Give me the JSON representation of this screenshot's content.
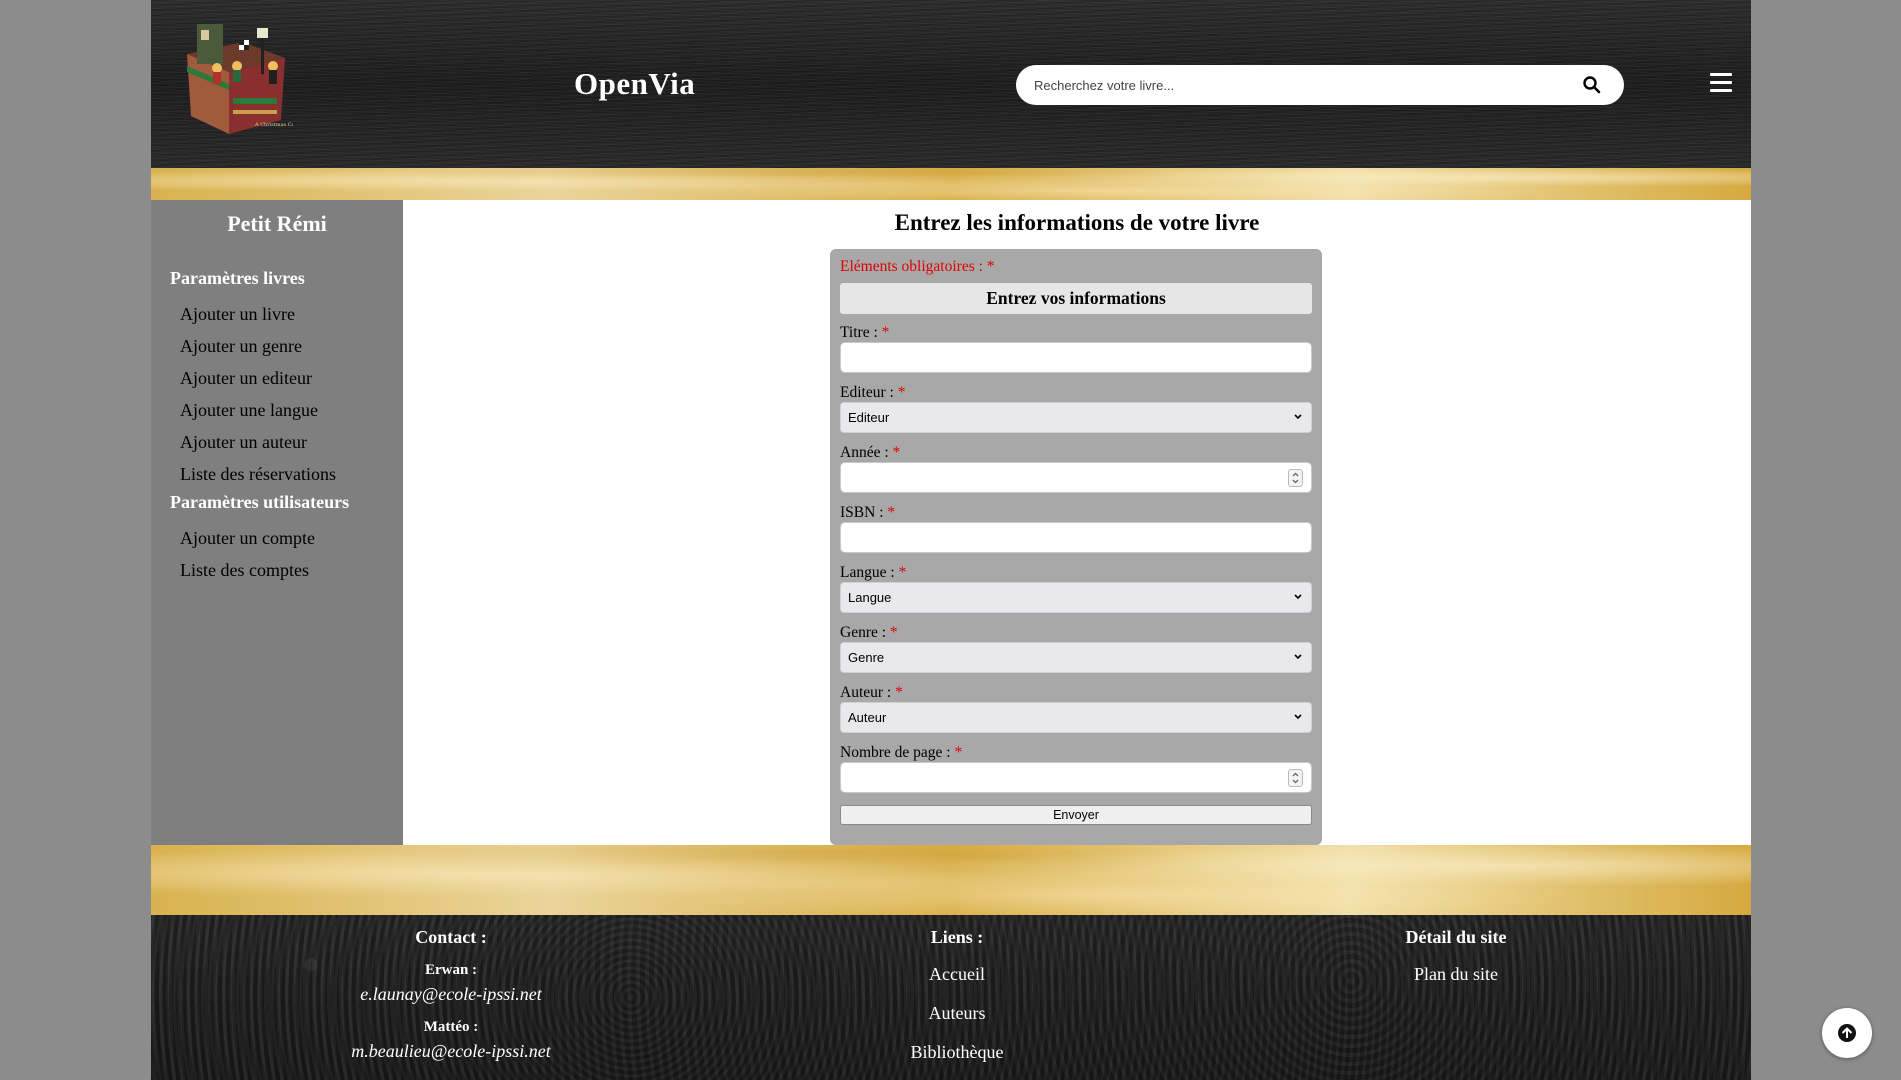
{
  "header": {
    "brand": "OpenVia",
    "search_placeholder": "Recherchez votre livre..."
  },
  "sidebar": {
    "user": "Petit Rémi",
    "sections": [
      {
        "title": "Paramètres livres",
        "links": [
          "Ajouter un livre",
          "Ajouter un genre",
          "Ajouter un editeur",
          "Ajouter une langue",
          "Ajouter un auteur",
          "Liste des réservations"
        ]
      },
      {
        "title": "Paramètres utilisateurs",
        "links": [
          "Ajouter un compte",
          "Liste des comptes"
        ]
      }
    ]
  },
  "main": {
    "title": "Entrez les informations de votre livre",
    "form": {
      "required_note": "Eléments obligatoires : *",
      "heading": "Entrez vos informations",
      "fields": [
        {
          "label": "Titre :",
          "star": "*",
          "type": "text",
          "value": ""
        },
        {
          "label": "Editeur :",
          "star": "*",
          "type": "select",
          "value": "Editeur"
        },
        {
          "label": "Année :",
          "star": "*",
          "type": "number",
          "value": ""
        },
        {
          "label": "ISBN :",
          "star": "*",
          "type": "text",
          "value": ""
        },
        {
          "label": "Langue :",
          "star": "*",
          "type": "select",
          "value": "Langue"
        },
        {
          "label": "Genre :",
          "star": "*",
          "type": "select",
          "value": "Genre"
        },
        {
          "label": "Auteur :",
          "star": "*",
          "type": "select",
          "value": "Auteur"
        },
        {
          "label": "Nombre de page :",
          "star": "*",
          "type": "number",
          "value": ""
        }
      ],
      "submit": "Envoyer"
    }
  },
  "footer": {
    "contact": {
      "title": "Contact :",
      "people": [
        {
          "name": "Erwan :",
          "email": "e.launay@ecole-ipssi.net"
        },
        {
          "name": "Mattéo :",
          "email": "m.beaulieu@ecole-ipssi.net"
        }
      ]
    },
    "links": {
      "title": "Liens :",
      "items": [
        "Accueil",
        "Auteurs",
        "Bibliothèque"
      ]
    },
    "detail": {
      "title": "Détail du site",
      "items": [
        "Plan du site"
      ]
    }
  },
  "colors": {
    "sidebar_bg": "#7f7f7f",
    "form_bg": "#a8a8a8",
    "required": "#e00000",
    "header_bg": "#262626"
  },
  "icons": [
    "logo-image",
    "search-icon",
    "menu-icon",
    "chevron-down-icon",
    "arrow-up-icon"
  ]
}
